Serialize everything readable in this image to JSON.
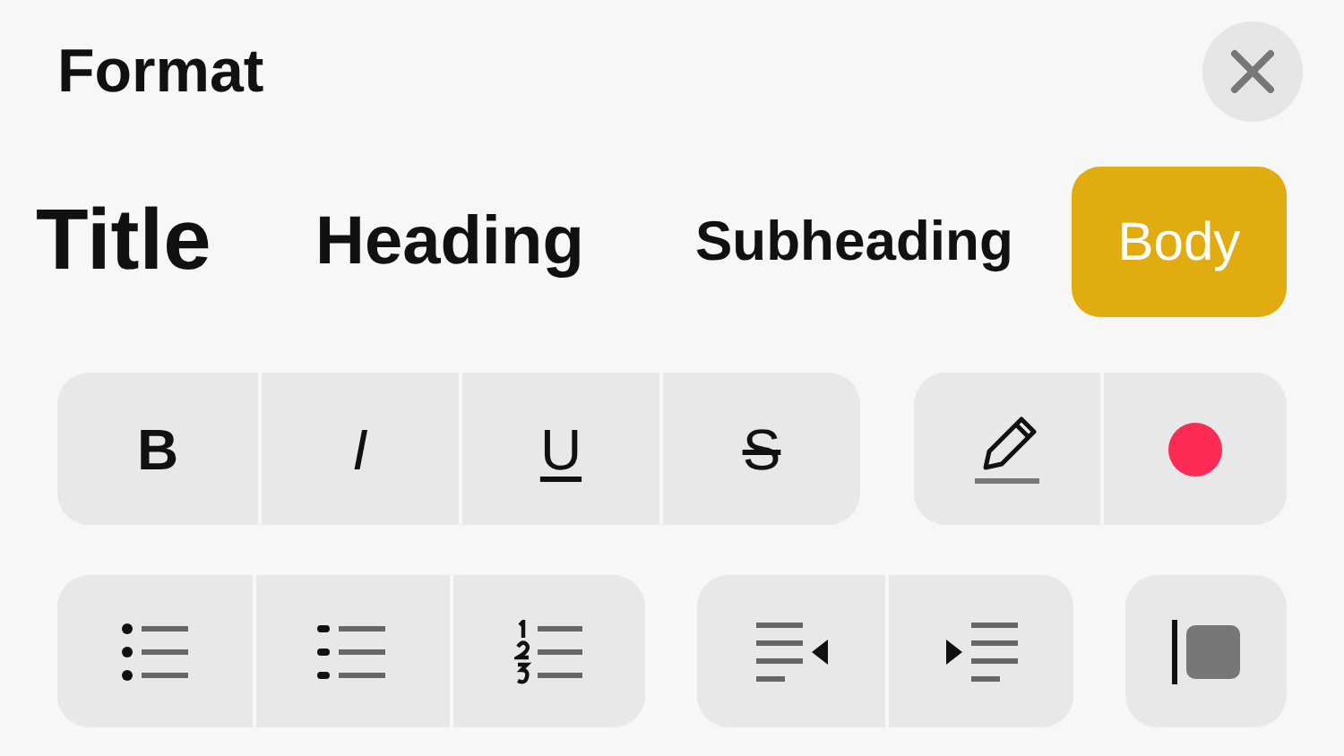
{
  "title": "Format",
  "styles": [
    {
      "label": "Title",
      "kind": "title",
      "selected": false
    },
    {
      "label": "Heading",
      "kind": "heading",
      "selected": false
    },
    {
      "label": "Subheading",
      "kind": "subheading",
      "selected": false
    },
    {
      "label": "Body",
      "kind": "body",
      "selected": true
    }
  ],
  "text_styles": [
    {
      "label": "B",
      "kind": "bold"
    },
    {
      "label": "I",
      "kind": "italic"
    },
    {
      "label": "U",
      "kind": "underline"
    },
    {
      "label": "S",
      "kind": "strikethrough"
    }
  ]
}
